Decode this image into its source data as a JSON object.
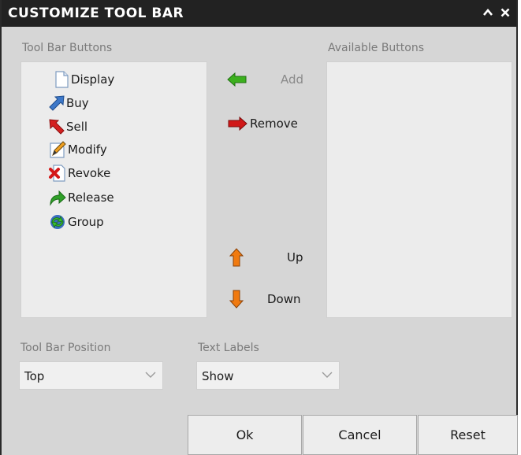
{
  "dialog": {
    "title": "CUSTOMIZE TOOL BAR",
    "title_buttons": {
      "minimize_glyph": "⌃",
      "close_glyph": "✕"
    }
  },
  "toolbar_buttons": {
    "label": "Tool Bar Buttons",
    "items": [
      {
        "label": "Display",
        "icon": "document-icon"
      },
      {
        "label": "Buy",
        "icon": "buy-arrow-icon"
      },
      {
        "label": "Sell",
        "icon": "sell-arrow-icon"
      },
      {
        "label": "Modify",
        "icon": "modify-pencil-icon"
      },
      {
        "label": "Revoke",
        "icon": "revoke-x-icon"
      },
      {
        "label": "Release",
        "icon": "release-arrow-icon"
      },
      {
        "label": "Group",
        "icon": "group-cycle-icon"
      }
    ]
  },
  "available_buttons": {
    "label": "Available Buttons",
    "items": []
  },
  "actions": {
    "add": "Add",
    "remove": "Remove",
    "up": "Up",
    "down": "Down"
  },
  "position": {
    "label": "Tool Bar Position",
    "value": "Top"
  },
  "text_labels": {
    "label": "Text Labels",
    "value": "Show"
  },
  "footer": {
    "ok": "Ok",
    "cancel": "Cancel",
    "reset": "Reset"
  },
  "colors": {
    "titlebar": "#222222",
    "background": "#d6d6d6",
    "listbox": "#ececec",
    "add_arrow": "#3cb01e",
    "remove_arrow": "#d01818",
    "up_down_arrow": "#f07a10"
  }
}
